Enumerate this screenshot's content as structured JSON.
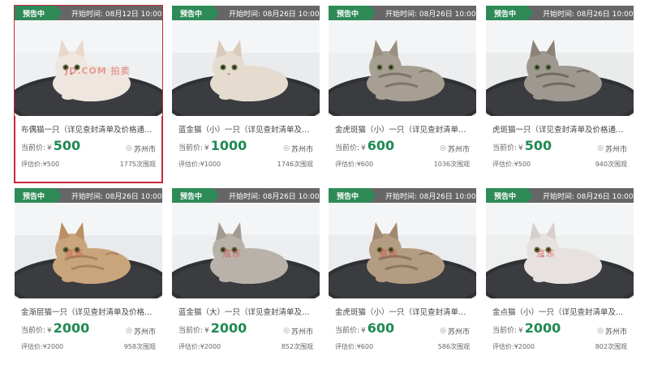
{
  "cards": [
    {
      "status": "预告中",
      "start": "开始时间: 08月12日 10:00",
      "title": "布偶猫一只（详见查封清单及价格通知...",
      "price_label": "当前价:",
      "currency": "¥",
      "price": "500",
      "city": "苏州市",
      "eval_label": "评估价:¥500",
      "views": "1775次围观",
      "watermark": "JD.COM 拍卖",
      "selected": true
    },
    {
      "status": "预告中",
      "start": "开始时间: 08月26日 10:00",
      "title": "蓝金猫（小）一只（详见查封清单及价...",
      "price_label": "当前价:",
      "currency": "¥",
      "price": "1000",
      "city": "苏州市",
      "eval_label": "评估价:¥1000",
      "views": "1746次围观",
      "watermark": ""
    },
    {
      "status": "预告中",
      "start": "开始时间: 08月26日 10:00",
      "title": "金虎斑猫（小）一只（详见查封清单及...",
      "price_label": "当前价:",
      "currency": "¥",
      "price": "600",
      "city": "苏州市",
      "eval_label": "评估价:¥600",
      "views": "1036次围观",
      "watermark": ""
    },
    {
      "status": "预告中",
      "start": "开始时间: 08月26日 10:00",
      "title": "虎斑猫一只（详见查封清单及价格通知...",
      "price_label": "当前价:",
      "currency": "¥",
      "price": "500",
      "city": "苏州市",
      "eval_label": "评估价:¥500",
      "views": "940次围观",
      "watermark": ""
    },
    {
      "status": "预告中",
      "start": "开始时间: 08月26日 10:00",
      "title": "金渐层猫一只（详见查封清单及价格通...",
      "price_label": "当前价:",
      "currency": "¥",
      "price": "2000",
      "city": "苏州市",
      "eval_label": "评估价:¥2000",
      "views": "958次围观",
      "watermark": "京东"
    },
    {
      "status": "预告中",
      "start": "开始时间: 08月26日 10:00",
      "title": "蓝金猫（大）一只（详见查封清单及价...",
      "price_label": "当前价:",
      "currency": "¥",
      "price": "2000",
      "city": "苏州市",
      "eval_label": "评估价:¥2000",
      "views": "852次围观",
      "watermark": "京东"
    },
    {
      "status": "预告中",
      "start": "开始时间: 08月26日 10:00",
      "title": "金虎斑猫（小）一只（详见查封清单及...",
      "price_label": "当前价:",
      "currency": "¥",
      "price": "600",
      "city": "苏州市",
      "eval_label": "评估价:¥600",
      "views": "586次围观",
      "watermark": "京东"
    },
    {
      "status": "预告中",
      "start": "开始时间: 08月26日 10:00",
      "title": "金点猫（小）一只（详见查封清单及...",
      "price_label": "当前价:",
      "currency": "¥",
      "price": "2000",
      "city": "苏州市",
      "eval_label": "评估价:¥2000",
      "views": "802次围观",
      "watermark": "京东"
    }
  ],
  "colors": {
    "status_green": "#2e8b57",
    "price_green": "#1f8a52",
    "topbar_grey": "#666666",
    "selected_border": "#c5283d"
  },
  "icons": {
    "location": "location-pin-icon"
  }
}
